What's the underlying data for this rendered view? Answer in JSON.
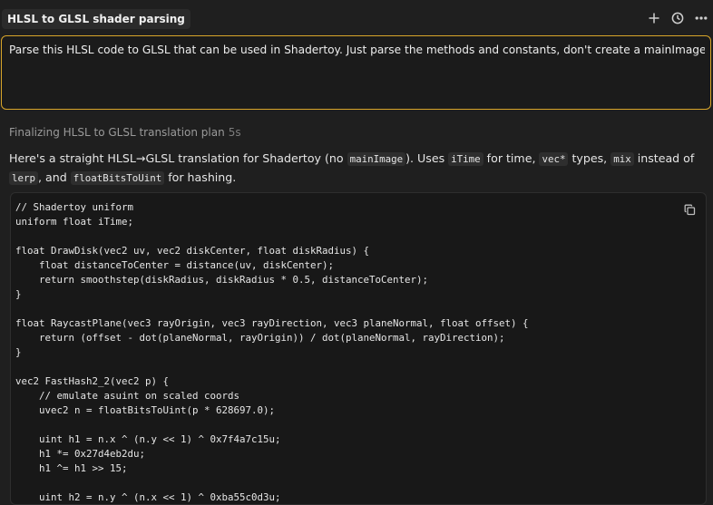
{
  "topbar": {
    "title": "HLSL to GLSL shader parsing",
    "icons": [
      "plus-icon",
      "history-icon",
      "more-icon"
    ]
  },
  "prompt": {
    "text": "Parse this HLSL code to GLSL that can be used in Shadertoy. Just parse the methods and constants, don't create a mainImage function."
  },
  "status": {
    "label": "Finalizing HLSL to GLSL translation plan",
    "time": "5s"
  },
  "answer": {
    "t1": "Here's a straight HLSL→GLSL translation for Shadertoy (no ",
    "c1": "mainImage",
    "t2": "). Uses ",
    "c2": "iTime",
    "t3": " for time, ",
    "c3": "vec*",
    "t4": " types, ",
    "c4": "mix",
    "t5": " instead of ",
    "c5": "lerp",
    "t6": ", and ",
    "c6": "floatBitsToUint",
    "t7": " for hashing."
  },
  "code": {
    "lines": [
      "// Shadertoy uniform",
      "uniform float iTime;",
      "",
      "float DrawDisk(vec2 uv, vec2 diskCenter, float diskRadius) {",
      "    float distanceToCenter = distance(uv, diskCenter);",
      "    return smoothstep(diskRadius, diskRadius * 0.5, distanceToCenter);",
      "}",
      "",
      "float RaycastPlane(vec3 rayOrigin, vec3 rayDirection, vec3 planeNormal, float offset) {",
      "    return (offset - dot(planeNormal, rayOrigin)) / dot(planeNormal, rayDirection);",
      "}",
      "",
      "vec2 FastHash2_2(vec2 p) {",
      "    // emulate asuint on scaled coords",
      "    uvec2 n = floatBitsToUint(p * 628697.0);",
      "",
      "    uint h1 = n.x ^ (n.y << 1) ^ 0x7f4a7c15u;",
      "    h1 *= 0x27d4eb2du;",
      "    h1 ^= h1 >> 15;",
      "",
      "    uint h2 = n.y ^ (n.x << 1) ^ 0xba55c0d3u;"
    ]
  },
  "colors": {
    "accent_border": "#d9a62a",
    "background": "#1f1f1f"
  }
}
